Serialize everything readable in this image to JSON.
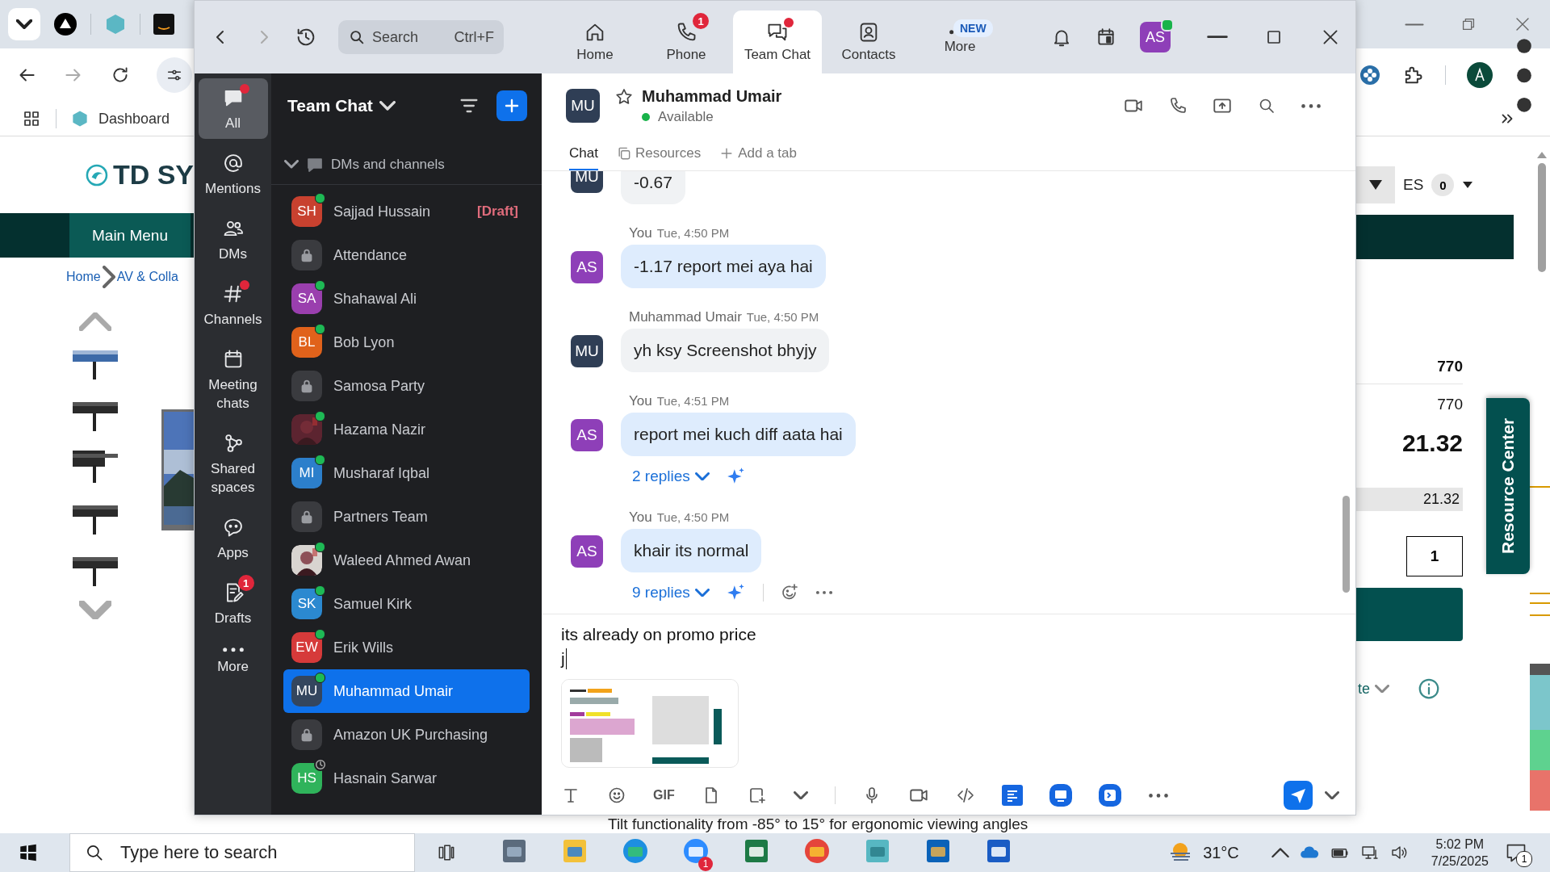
{
  "browser_left": {
    "bookmark": "Dashboard",
    "logo": "TD SY",
    "menu_button": "Main Menu",
    "breadcrumbs": [
      "Home",
      "AV & Colla"
    ]
  },
  "browser_right": {
    "language": "ES",
    "cart_count": "0",
    "price_rows": [
      {
        "kind": "bold",
        "value": "770"
      },
      {
        "kind": "plain",
        "value": "770"
      },
      {
        "kind": "large",
        "value": "21.32"
      },
      {
        "kind": "shaded",
        "value": "21.32"
      }
    ],
    "quantity": "1",
    "link_fragment": "te",
    "side_tab": "Resource Center"
  },
  "page_footer_text": "Tilt functionality from -85° to 15° for ergonomic viewing angles",
  "zoom": {
    "search": {
      "placeholder": "Search",
      "shortcut": "Ctrl+F"
    },
    "nav_tabs": [
      {
        "label": "Home",
        "selected": false
      },
      {
        "label": "Phone",
        "selected": false,
        "badge": "1"
      },
      {
        "label": "Team Chat",
        "selected": true,
        "dot": true
      },
      {
        "label": "Contacts",
        "selected": false
      },
      {
        "label": "More",
        "selected": false,
        "tag": "NEW"
      }
    ],
    "user_avatar": {
      "initials": "AS",
      "online": true
    },
    "rail": [
      {
        "label": "All",
        "selected": true,
        "dot": true
      },
      {
        "label": "Mentions",
        "selected": false
      },
      {
        "label": "DMs",
        "selected": false
      },
      {
        "label": "Channels",
        "selected": false,
        "dot": true
      },
      {
        "label": "Meeting chats",
        "selected": false
      },
      {
        "label": "Shared spaces",
        "selected": false
      },
      {
        "label": "Apps",
        "selected": false
      },
      {
        "label": "Drafts",
        "selected": false,
        "badge": "1"
      },
      {
        "label": "More",
        "selected": false
      }
    ],
    "list_title": "Team Chat",
    "section": {
      "label": "DMs and channels",
      "expanded": true
    },
    "conversations": [
      {
        "kind": "person",
        "initials": "SH",
        "color": "#c8412f",
        "name": "Sajjad Hussain",
        "online": true,
        "draft": "[Draft]",
        "selected": false
      },
      {
        "kind": "channel",
        "name": "Attendance",
        "selected": false
      },
      {
        "kind": "person",
        "initials": "SA",
        "color": "#9a3fae",
        "name": "Shahawal Ali",
        "online": true,
        "selected": false
      },
      {
        "kind": "person",
        "initials": "BL",
        "color": "#e0621b",
        "name": "Bob Lyon",
        "online": true,
        "selected": false
      },
      {
        "kind": "channel",
        "name": "Samosa Party",
        "selected": false
      },
      {
        "color": "#5c2430",
        "name": "Hazama Nazir",
        "online": true,
        "selected": false
      },
      {
        "kind": "person",
        "initials": "MI",
        "color": "#2c7fcb",
        "name": "Musharaf Iqbal",
        "online": true,
        "selected": false
      },
      {
        "kind": "channel",
        "name": "Partners Team",
        "selected": false
      },
      {
        "color": "#d8d4d0",
        "name": "Waleed Ahmed Awan",
        "online": true,
        "selected": false
      },
      {
        "kind": "person",
        "initials": "SK",
        "color": "#2b89d0",
        "name": "Samuel Kirk",
        "online": true,
        "selected": false
      },
      {
        "kind": "person",
        "initials": "EW",
        "color": "#d63a3a",
        "name": "Erik Wills",
        "online": true,
        "selected": false
      },
      {
        "kind": "person",
        "initials": "MU",
        "color": "#34465e",
        "name": "Muhammad Umair",
        "online": true,
        "selected": true
      },
      {
        "kind": "channel",
        "name": "Amazon UK Purchasing",
        "selected": false
      },
      {
        "kind": "person",
        "initials": "HS",
        "color": "#2fb35b",
        "name": "Hasnain Sarwar",
        "away": true,
        "selected": false
      }
    ],
    "chat": {
      "contact": {
        "initials": "MU",
        "name": "Muhammad Umair",
        "status": "Available",
        "starred": false
      },
      "tabs": [
        {
          "kind": "plain",
          "label": "Chat",
          "selected": true
        },
        {
          "kind": "resources",
          "label": "Resources",
          "selected": false
        },
        {
          "kind": "add",
          "label": "Add a tab",
          "selected": false
        }
      ],
      "messages": [
        {
          "initials": "MU",
          "mine": false,
          "partial": true,
          "text": "-0.67"
        },
        {
          "sender": "You",
          "time": "Tue, 4:50 PM",
          "initials": "AS",
          "mine": true,
          "text": "-1.17 report mei aya hai"
        },
        {
          "sender": "Muhammad Umair",
          "time": "Tue, 4:50 PM",
          "initials": "MU",
          "mine": false,
          "text": "yh ksy Screenshot bhyjy"
        },
        {
          "sender": "You",
          "time": "Tue, 4:51 PM",
          "initials": "AS",
          "mine": true,
          "text": "report mei kuch diff aata hai",
          "replies": "2 replies"
        },
        {
          "sender": "You",
          "time": "Tue, 4:50 PM",
          "initials": "AS",
          "mine": true,
          "text": "khair its normal",
          "replies": "9 replies",
          "actions": true
        }
      ],
      "composer": {
        "lines": [
          "its already on promo price",
          "j"
        ],
        "attachment": {
          "kind": "picture"
        },
        "gif_label": "GIF"
      }
    }
  },
  "taskbar": {
    "search_placeholder": "Type here to search",
    "apps": [
      {
        "kind": "calculator"
      },
      {
        "kind": "explorer"
      },
      {
        "kind": "edge"
      },
      {
        "kind": "zoom",
        "badge": "1"
      },
      {
        "kind": "excel"
      },
      {
        "kind": "chrome"
      },
      {
        "kind": "hexagon"
      },
      {
        "kind": "outlook"
      },
      {
        "kind": "word"
      }
    ],
    "weather": "31°C",
    "time": "5:02 PM",
    "date": "7/25/2025",
    "notifications": "1"
  }
}
